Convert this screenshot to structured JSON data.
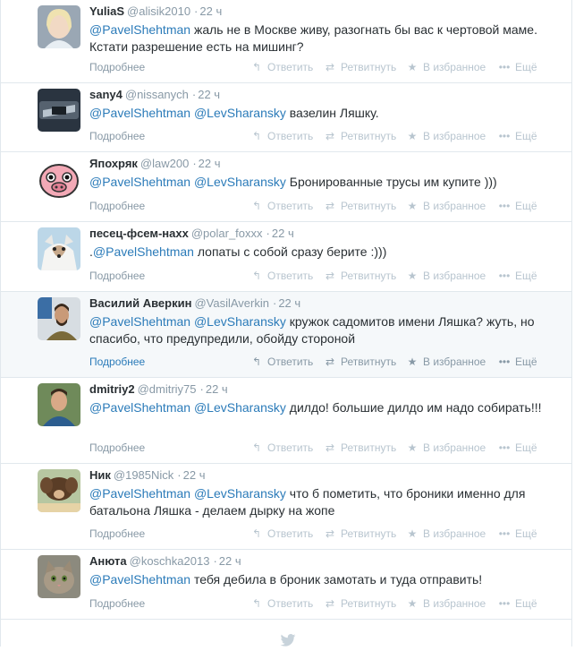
{
  "actions": {
    "details": "Подробнее",
    "reply": "Ответить",
    "retweet": "Ретвитнуть",
    "favorite": "В избранное",
    "more": "Ещё"
  },
  "tweets": [
    {
      "name": "YuliaS",
      "username": "@alisik2010",
      "dot": "·",
      "time": "22 ч",
      "mention1": "@PavelShehtman",
      "mention2": "",
      "body": " жаль не в Москве живу, разогнать бы вас к чертовой маме. Кстати разрешение есть на мишинг?"
    },
    {
      "name": "sany4",
      "username": "@nissanych",
      "dot": "·",
      "time": "22 ч",
      "mention1": "@PavelShehtman",
      "mention2": "@LevSharansky",
      "body": " вазелин Ляшку."
    },
    {
      "name": "Япохряк",
      "username": "@law200",
      "dot": "·",
      "time": "22 ч",
      "mention1": "@PavelShehtman",
      "mention2": "@LevSharansky",
      "body": " Бронированные трусы им купите )))"
    },
    {
      "name": "песец-фсем-нахх",
      "username": "@polar_foxxx",
      "dot": "·",
      "time": "22 ч",
      "prefix": ".",
      "mention1": "@PavelShehtman",
      "mention2": "",
      "body": " лопаты с собой сразу берите :)))"
    },
    {
      "name": "Василий Аверкин",
      "username": "@VasilAverkin",
      "dot": "·",
      "time": "22 ч",
      "mention1": "@PavelShehtman",
      "mention2": "@LevSharansky",
      "body": " кружок садомитов имени Ляшка? жуть, но спасибо, что предупредили, обойду стороной"
    },
    {
      "name": "dmitriy2",
      "username": "@dmitriy75",
      "dot": "·",
      "time": "22 ч",
      "mention1": "@PavelShehtman",
      "mention2": "@LevSharansky",
      "body": " дилдо! большие дилдо им надо собирать!!!"
    },
    {
      "name": "Ник",
      "username": "@1985Nick",
      "dot": "·",
      "time": "22 ч",
      "mention1": "@PavelShehtman",
      "mention2": "@LevSharansky",
      "body": " что б пометить, что броники именно для батальона Ляшка - делаем дырку на жопе"
    },
    {
      "name": "Анюта",
      "username": "@koschka2013",
      "dot": "·",
      "time": "22 ч",
      "mention1": "@PavelShehtman",
      "mention2": "",
      "body": " тебя дебила в броник замотать и туда отправить!"
    }
  ],
  "icons": {
    "reply": "reply-icon",
    "retweet": "retweet-icon",
    "favorite": "star-icon",
    "more": "more-icon",
    "footer": "twitter-bird-icon"
  },
  "colors": {
    "link": "#2b7bb9",
    "muted": "#8899a6",
    "faint": "#b8c5cf",
    "text": "#292f33",
    "divider": "#e1e8ed"
  }
}
